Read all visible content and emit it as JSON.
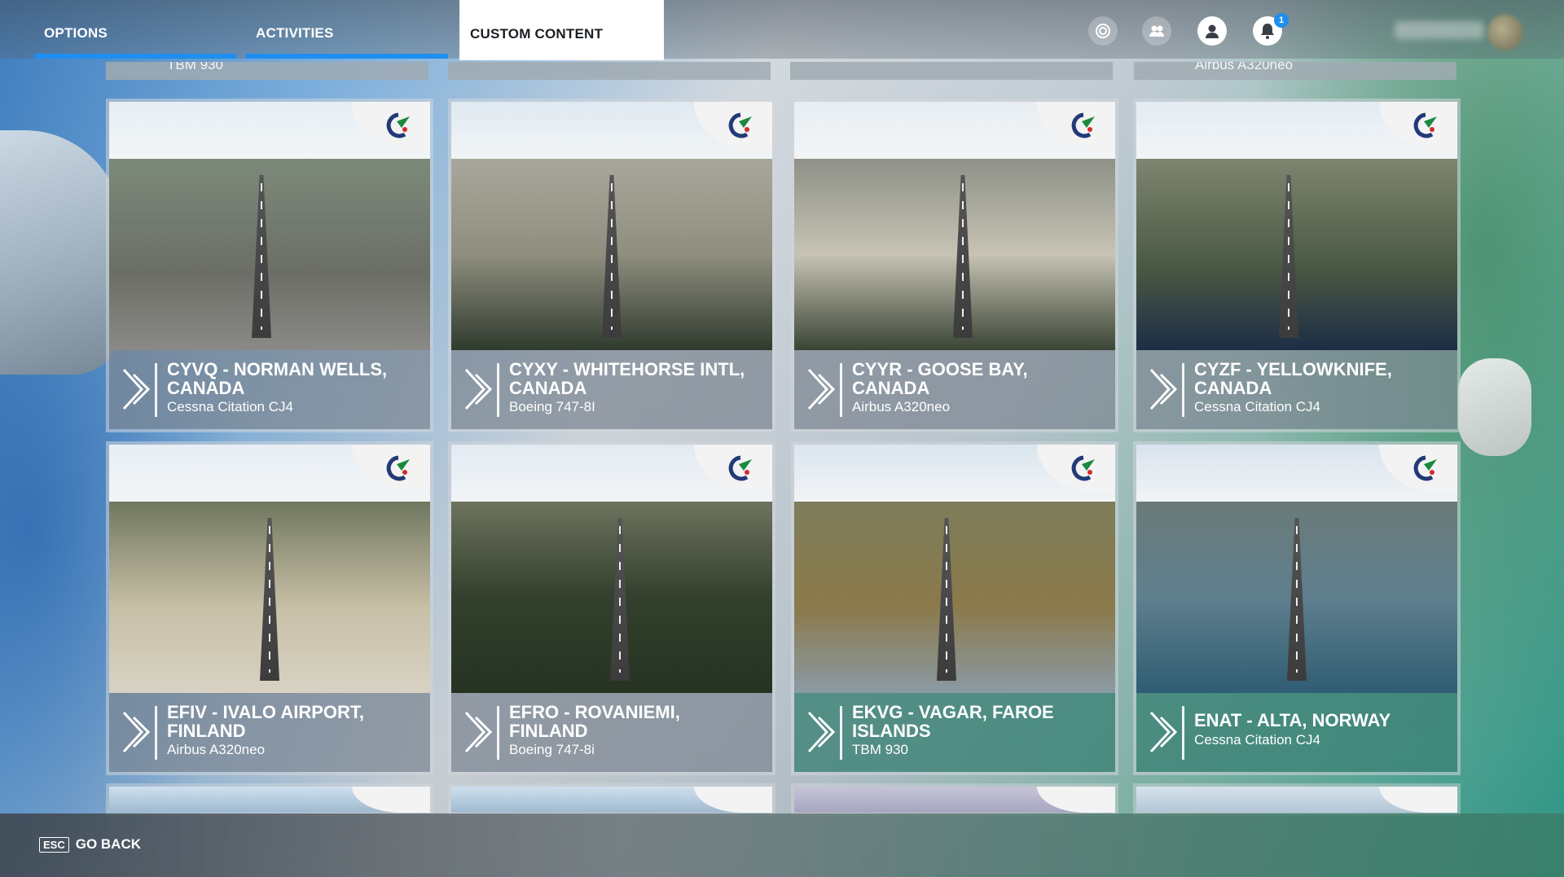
{
  "nav": {
    "tabs": [
      {
        "label": "OPTIONS",
        "active": false
      },
      {
        "label": "ACTIVITIES",
        "active": false
      },
      {
        "label": "CUSTOM CONTENT",
        "active": true
      }
    ],
    "notifications_count": "1",
    "accent_color": "#1e8ef0"
  },
  "top_cut_row": [
    "TBM 930",
    "",
    "",
    "Airbus A320neo"
  ],
  "cards": [
    {
      "title": "CYVQ - NORMAN WELLS, CANADA",
      "aircraft": "Cessna Citation CJ4",
      "theme": "grey"
    },
    {
      "title": "CYXY - WHITEHORSE INTL, CANADA",
      "aircraft": "Boeing 747-8I",
      "theme": "grey"
    },
    {
      "title": "CYYR - GOOSE BAY, CANADA",
      "aircraft": "Airbus A320neo",
      "theme": "grey"
    },
    {
      "title": "CYZF - YELLOWKNIFE, CANADA",
      "aircraft": "Cessna Citation CJ4",
      "theme": "grey"
    },
    {
      "title": "EFIV - IVALO AIRPORT, FINLAND",
      "aircraft": "Airbus A320neo",
      "theme": "grey"
    },
    {
      "title": "EFRO - ROVANIEMI, FINLAND",
      "aircraft": "Boeing 747-8i",
      "theme": "grey"
    },
    {
      "title": "EKVG - VAGAR, FAROE ISLANDS",
      "aircraft": "TBM 930",
      "theme": "teal"
    },
    {
      "title": "ENAT - ALTA, NORWAY",
      "aircraft": "Cessna Citation CJ4",
      "theme": "teal"
    }
  ],
  "footer": {
    "key": "ESC",
    "label": "GO BACK"
  }
}
